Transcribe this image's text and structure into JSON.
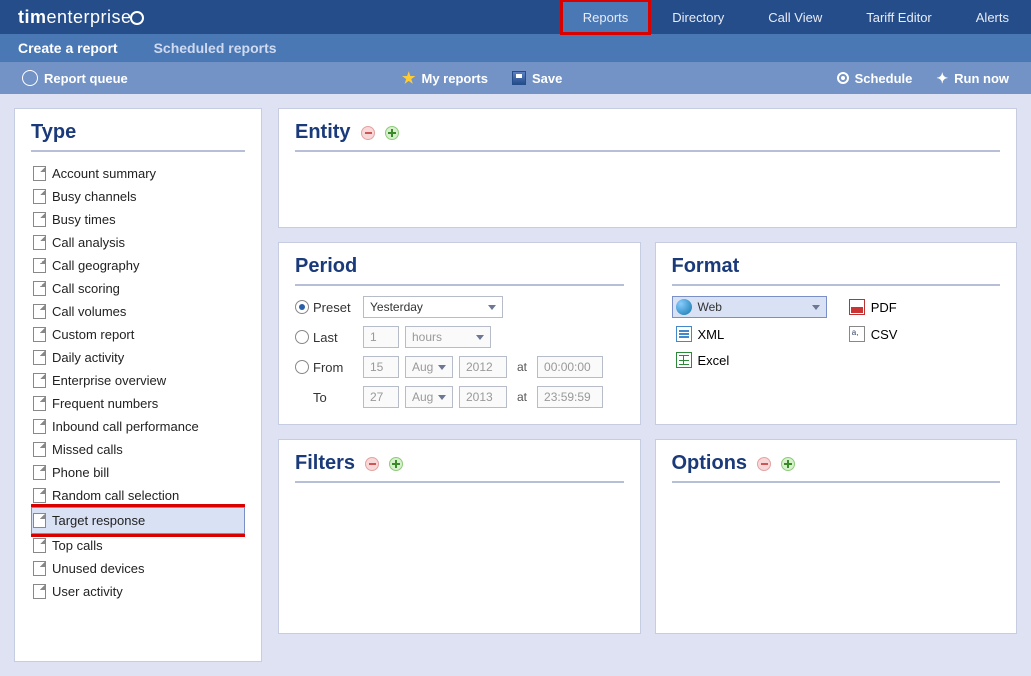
{
  "brand": {
    "bold": "tim",
    "light": "enterprise"
  },
  "topnav": {
    "items": [
      {
        "label": "Reports",
        "active": true,
        "highlight": true
      },
      {
        "label": "Directory"
      },
      {
        "label": "Call View"
      },
      {
        "label": "Tariff Editor"
      },
      {
        "label": "Alerts"
      }
    ]
  },
  "subnav": {
    "items": [
      {
        "label": "Create a report",
        "active": true
      },
      {
        "label": "Scheduled reports"
      }
    ]
  },
  "toolbar": {
    "report_queue": "Report queue",
    "my_reports": "My reports",
    "save": "Save",
    "schedule": "Schedule",
    "run_now": "Run now"
  },
  "panels": {
    "type": "Type",
    "entity": "Entity",
    "period": "Period",
    "format": "Format",
    "filters": "Filters",
    "options": "Options"
  },
  "type_list": [
    "Account summary",
    "Busy channels",
    "Busy times",
    "Call analysis",
    "Call geography",
    "Call scoring",
    "Call volumes",
    "Custom report",
    "Daily activity",
    "Enterprise overview",
    "Frequent numbers",
    "Inbound call performance",
    "Missed calls",
    "Phone bill",
    "Random call selection",
    "Target response",
    "Top calls",
    "Unused devices",
    "User activity"
  ],
  "type_selected": "Target response",
  "type_highlighted": "Target response",
  "period": {
    "mode": "preset",
    "preset": {
      "label": "Preset",
      "value": "Yesterday"
    },
    "last": {
      "label": "Last",
      "qty": "1",
      "unit": "hours"
    },
    "from": {
      "label": "From",
      "day": "15",
      "month": "Aug",
      "year": "2012",
      "time": "00:00:00"
    },
    "to": {
      "label": "To",
      "day": "27",
      "month": "Aug",
      "year": "2013",
      "time": "23:59:59"
    },
    "at": "at"
  },
  "format": {
    "items": [
      {
        "key": "web",
        "label": "Web",
        "selected": true
      },
      {
        "key": "pdf",
        "label": "PDF"
      },
      {
        "key": "xml",
        "label": "XML"
      },
      {
        "key": "csv",
        "label": "CSV"
      },
      {
        "key": "excel",
        "label": "Excel"
      }
    ]
  }
}
